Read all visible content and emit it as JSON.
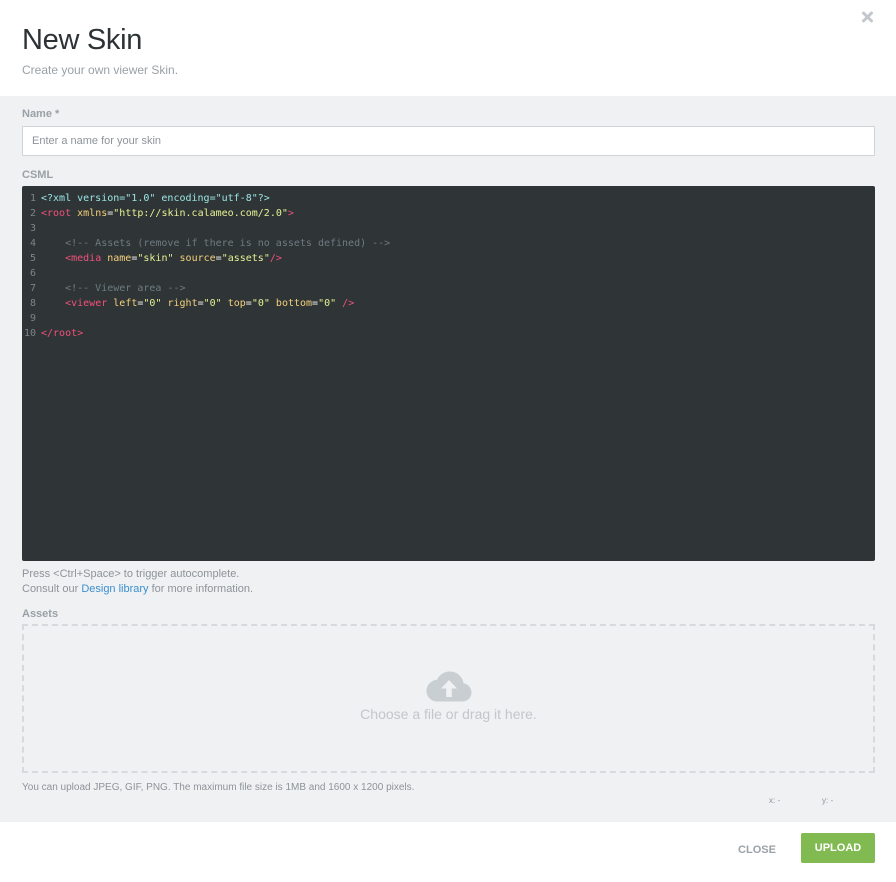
{
  "dialog": {
    "title": "New Skin",
    "subtitle": "Create your own viewer Skin.",
    "close_icon": "close-icon"
  },
  "form": {
    "name_label": "Name *",
    "name_placeholder": "Enter a name for your skin",
    "name_value": "",
    "csml_label": "CSML",
    "assets_label": "Assets"
  },
  "editor": {
    "background": "#2f3437",
    "lines": [
      {
        "num": "1",
        "text": "<?xml version=\"1.0\" encoding=\"utf-8\"?>"
      },
      {
        "num": "2",
        "text": "<root xmlns=\"http://skin.calameo.com/2.0\">"
      },
      {
        "num": "3",
        "text": ""
      },
      {
        "num": "4",
        "text": "    <!-- Assets (remove if there is no assets defined) -->"
      },
      {
        "num": "5",
        "text": "    <media name=\"skin\" source=\"assets\"/>"
      },
      {
        "num": "6",
        "text": ""
      },
      {
        "num": "7",
        "text": "    <!-- Viewer area -->"
      },
      {
        "num": "8",
        "text": "    <viewer left=\"0\" right=\"0\" top=\"0\" bottom=\"0\" />"
      },
      {
        "num": "9",
        "text": ""
      },
      {
        "num": "10",
        "text": "</root>"
      }
    ]
  },
  "hints": {
    "autocomplete": "Press <Ctrl+Space> to trigger autocomplete.",
    "consult_prefix": "Consult our ",
    "design_library_link": "Design library",
    "consult_suffix": " for more information."
  },
  "dropzone": {
    "icon": "cloud-upload-icon",
    "text": "Choose a file or drag it here.",
    "upload_note": "You can upload JPEG, GIF, PNG. The maximum file size is 1MB and 1600 x 1200 pixels."
  },
  "coords": {
    "x_label": "x:",
    "x_value": "-",
    "y_label": "y:",
    "y_value": "-"
  },
  "footer": {
    "close_label": "CLOSE",
    "upload_label": "UPLOAD"
  },
  "colors": {
    "accent_green": "#82ba52",
    "link_blue": "#3c8fcf",
    "panel_bg": "#eff1f3"
  }
}
